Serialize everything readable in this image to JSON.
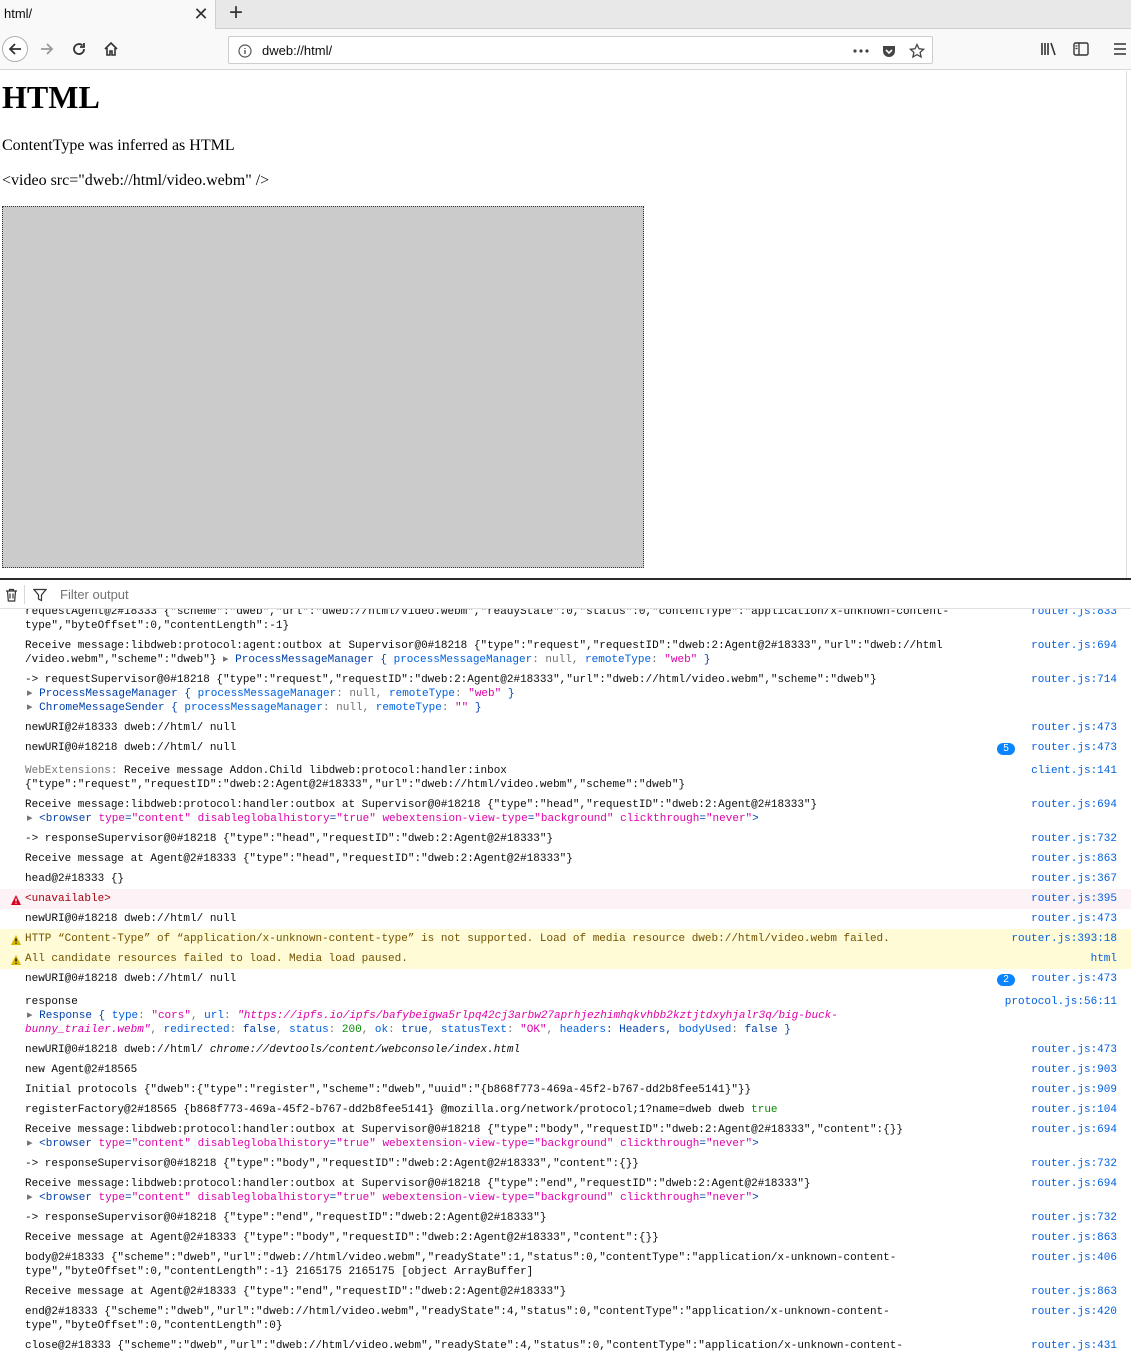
{
  "tab": {
    "title": "html/",
    "close": "✕",
    "new": "+"
  },
  "url": {
    "address": "dweb://html/"
  },
  "page": {
    "heading": "HTML",
    "line1": "ContentType was inferred as HTML",
    "line2": "<video src=\"dweb://html/video.webm\" />"
  },
  "console": {
    "filter_placeholder": "Filter output",
    "rows": [
      {
        "l1": "requestAgent@2#18333 {\"scheme\":\"dweb\",\"url\":\"dweb://html/video.webm\",\"readyState\":0,\"status\":0,\"contentType\":\"application/x-unknown-content-",
        "l2": "type\",\"byteOffset\":0,\"contentLength\":-1}",
        "src": "router.js:833"
      },
      {
        "l1": "Receive message:libdweb:protocol:agent:outbox at Supervisor@0#18218 {\"type\":\"request\",\"requestID\":\"dweb:2:Agent@2#18333\",\"url\":\"dweb://html",
        "l2a": "/video.webm\",\"scheme\":\"dweb\"} ",
        "l2b": "ProcessMessageManager { ",
        "l2c": "processMessageManager",
        "l2d": ": null, ",
        "l2e": "remoteType",
        "l2f": ": ",
        "l2g": "\"web\"",
        "l2h": " }",
        "src": "router.js:694"
      },
      {
        "l1": "-> requestSupervisor@0#18218 {\"type\":\"request\",\"requestID\":\"dweb:2:Agent@2#18333\",\"url\":\"dweb://html/video.webm\",\"scheme\":\"dweb\"}",
        "l2a": "ProcessMessageManager { ",
        "l2b": "processMessageManager",
        "l2c": ": null, ",
        "l2d": "remoteType",
        "l2e": ": ",
        "l2f": "\"web\"",
        "l2g": " }",
        "l3a": "ChromeMessageSender { ",
        "l3b": "processMessageManager",
        "l3c": ": null, ",
        "l3d": "remoteType",
        "l3e": ": ",
        "l3f": "\"\"",
        "l3g": " }",
        "src": "router.js:714"
      },
      {
        "l1": "newURI@2#18333 dweb://html/ null",
        "src": "router.js:473"
      },
      {
        "l1": "newURI@0#18218 dweb://html/ null",
        "badge": "5",
        "src": "router.js:473"
      },
      {
        "l1a": "WebExtensions: ",
        "l1b": "Receive message Addon.Child libdweb:protocol:handler:inbox",
        "l2": "{\"type\":\"request\",\"requestID\":\"dweb:2:Agent@2#18333\",\"url\":\"dweb://html/video.webm\",\"scheme\":\"dweb\"}",
        "src": "client.js:141"
      },
      {
        "l1": "Receive message:libdweb:protocol:handler:outbox at Supervisor@0#18218 {\"type\":\"head\",\"requestID\":\"dweb:2:Agent@2#18333\"}",
        "src": "router.js:694"
      },
      {
        "l1": "-> responseSupervisor@0#18218 {\"type\":\"head\",\"requestID\":\"dweb:2:Agent@2#18333\"}",
        "src": "router.js:732"
      },
      {
        "l1": "Receive message at Agent@2#18333 {\"type\":\"head\",\"requestID\":\"dweb:2:Agent@2#18333\"}",
        "src": "router.js:863"
      },
      {
        "l1": "head@2#18333 {}",
        "src": "router.js:367"
      },
      {
        "l1": "<unavailable>",
        "src": "router.js:395"
      },
      {
        "l1": "newURI@0#18218 dweb://html/ null",
        "src": "router.js:473"
      },
      {
        "l1": "HTTP “Content-Type” of “application/x-unknown-content-type” is not supported. Load of media resource dweb://html/video.webm failed.",
        "src": "router.js:393:18"
      },
      {
        "l1": "All candidate resources failed to load. Media load paused.",
        "src": "html"
      },
      {
        "l1": "newURI@0#18218 dweb://html/ null",
        "badge": "2",
        "src": "router.js:473"
      },
      {
        "l1": "response",
        "l2a": "Response { ",
        "l2b": "type",
        "l2c": ": ",
        "l2d": "\"cors\"",
        "l2e": ", ",
        "l2f": "url",
        "l2g": ": ",
        "l2h": "\"https://ipfs.io/ipfs/bafybeigwa5rlpq42cj3arbw27aprhjezhimhqkvhbb2kztjtdxyhjalr3q/big-buck-",
        "l3a": "bunny_trailer.webm\"",
        "l3b": ", ",
        "l3c": "redirected",
        "l3d": ": ",
        "l3e": "false",
        "l3f": ", ",
        "l3g": "status",
        "l3h": ": ",
        "l3i": "200",
        "l3j": ", ",
        "l3k": "ok",
        "l3l": ": ",
        "l3m": "true",
        "l3n": ", ",
        "l3o": "statusText",
        "l3p": ": ",
        "l3q": "\"OK\"",
        "l3r": ", ",
        "l3s": "headers",
        "l3t": ": Headers, ",
        "l3u": "bodyUsed",
        "l3v": ": ",
        "l3w": "false",
        "l3x": " }",
        "src": "protocol.js:56:11"
      },
      {
        "l1a": "newURI@0#18218 dweb://html/ ",
        "l1b": "chrome://devtools/content/webconsole/index.html",
        "src": "router.js:473"
      },
      {
        "l1": "new Agent@2#18565",
        "src": "router.js:903"
      },
      {
        "l1": "Initial protocols {\"dweb\":{\"type\":\"register\",\"scheme\":\"dweb\",\"uuid\":\"{b868f773-469a-45f2-b767-dd2b8fee5141}\"}}",
        "src": "router.js:909"
      },
      {
        "l1a": "registerFactory@2#18565 {b868f773-469a-45f2-b767-dd2b8fee5141} @mozilla.org/network/protocol;1?name=dweb dweb ",
        "l1b": "true",
        "src": "router.js:104"
      },
      {
        "l1": "Receive message:libdweb:protocol:handler:outbox at Supervisor@0#18218 {\"type\":\"body\",\"requestID\":\"dweb:2:Agent@2#18333\",\"content\":{}}",
        "src": "router.js:694"
      },
      {
        "l1": "-> responseSupervisor@0#18218 {\"type\":\"body\",\"requestID\":\"dweb:2:Agent@2#18333\",\"content\":{}}",
        "src": "router.js:732"
      },
      {
        "l1": "Receive message:libdweb:protocol:handler:outbox at Supervisor@0#18218 {\"type\":\"end\",\"requestID\":\"dweb:2:Agent@2#18333\"}",
        "src": "router.js:694"
      },
      {
        "l1": "-> responseSupervisor@0#18218 {\"type\":\"end\",\"requestID\":\"dweb:2:Agent@2#18333\"}",
        "src": "router.js:732"
      },
      {
        "l1": "Receive message at Agent@2#18333 {\"type\":\"body\",\"requestID\":\"dweb:2:Agent@2#18333\",\"content\":{}}",
        "src": "router.js:863"
      },
      {
        "l1": "body@2#18333 {\"scheme\":\"dweb\",\"url\":\"dweb://html/video.webm\",\"readyState\":1,\"status\":0,\"contentType\":\"application/x-unknown-content-",
        "l2": "type\",\"byteOffset\":0,\"contentLength\":-1} 2165175 2165175 [object ArrayBuffer]",
        "src": "router.js:406"
      },
      {
        "l1": "Receive message at Agent@2#18333 {\"type\":\"end\",\"requestID\":\"dweb:2:Agent@2#18333\"}",
        "src": "router.js:863"
      },
      {
        "l1": "end@2#18333 {\"scheme\":\"dweb\",\"url\":\"dweb://html/video.webm\",\"readyState\":4,\"status\":0,\"contentType\":\"application/x-unknown-content-",
        "l2": "type\",\"byteOffset\":0,\"contentLength\":0}",
        "src": "router.js:420"
      },
      {
        "l1": "close@2#18333 {\"scheme\":\"dweb\",\"url\":\"dweb://html/video.webm\",\"readyState\":4,\"status\":0,\"contentType\":\"application/x-unknown-content-",
        "src": "router.js:431"
      }
    ],
    "browser_el": {
      "open": "browser ",
      "type_attr": "type",
      "eq": "=",
      "type_val": "\"content\"",
      "sp": " ",
      "dgh_attr": "disableglobalhistory",
      "dgh_val": "\"true\"",
      "wvt_attr": "webextension-view-type",
      "wvt_val": "\"background\"",
      "ct_attr": "clickthrough",
      "ct_val": "\"never\"",
      "close": ">"
    }
  },
  "colors": {
    "link": "#0060df",
    "badge": "#0a84ff",
    "error_bg": "#fdf2f5",
    "warn_bg": "#fffbd6"
  },
  "icons": [
    "back-icon",
    "forward-icon",
    "reload-icon",
    "home-icon",
    "info-icon",
    "more-icon",
    "pocket-icon",
    "star-icon",
    "library-icon",
    "sidebar-icon",
    "menu-icon",
    "trash-icon",
    "filter-icon",
    "error-icon",
    "warning-icon"
  ]
}
